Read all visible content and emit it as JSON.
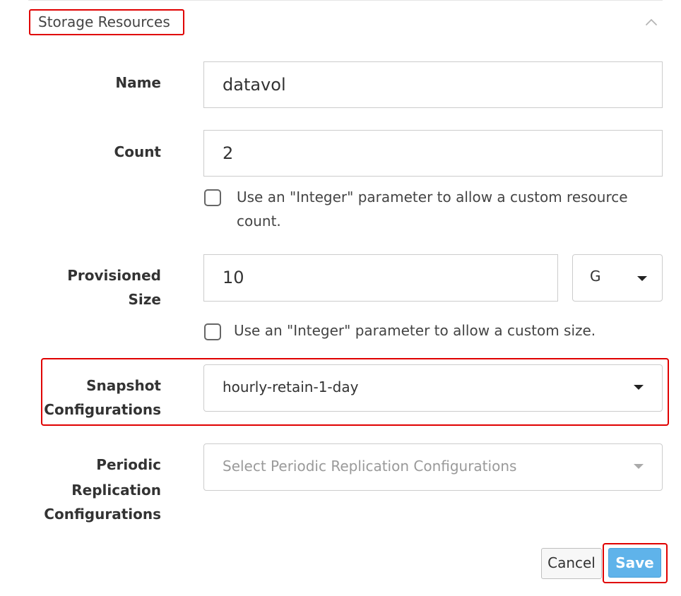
{
  "section": {
    "title": "Storage Resources",
    "collapse_icon": "chevron-up-icon"
  },
  "fields": {
    "name": {
      "label": "Name",
      "value": "datavol"
    },
    "count": {
      "label": "Count",
      "value": "2",
      "param_checkbox": {
        "checked": false,
        "label": "Use an \"Integer\" parameter to allow a custom resource count."
      }
    },
    "provisioned_size": {
      "label_line1": "Provisioned",
      "label_line2": "Size",
      "value": "10",
      "unit": "G",
      "param_checkbox": {
        "checked": false,
        "label": "Use an \"Integer\" parameter to allow a custom size."
      }
    },
    "snapshot_configurations": {
      "label_line1": "Snapshot",
      "label_line2": "Configurations",
      "value": "hourly-retain-1-day"
    },
    "periodic_replication": {
      "label_line1": "Periodic",
      "label_line2": "Replication",
      "label_line3": "Configurations",
      "placeholder": "Select Periodic Replication Configurations"
    }
  },
  "actions": {
    "cancel_label": "Cancel",
    "save_label": "Save"
  },
  "colors": {
    "highlight": "#e00000",
    "primary_button": "#5fb3ea",
    "border": "#cccccc"
  }
}
